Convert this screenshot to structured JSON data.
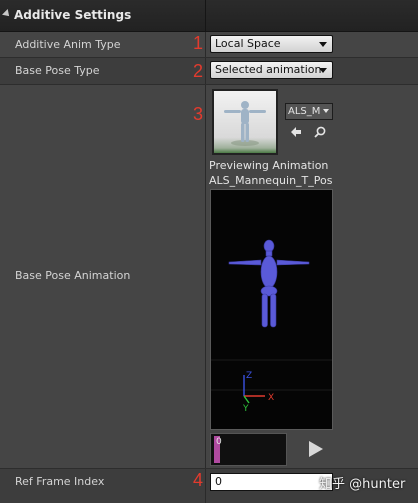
{
  "section": {
    "title": "Additive Settings"
  },
  "rows": {
    "additive_anim_type": {
      "label": "Additive Anim Type",
      "value": "Local Space",
      "marker": "1"
    },
    "base_pose_type": {
      "label": "Base Pose Type",
      "value": "Selected animation",
      "marker": "2"
    },
    "base_pose_animation": {
      "label": "Base Pose Animation",
      "marker": "3",
      "asset_combo": "ALS_M",
      "preview_line1": "Previewing Animation",
      "preview_line2": "ALS_Mannequin_T_Pos",
      "scrub_frame": "0"
    },
    "ref_frame_index": {
      "label": "Ref Frame Index",
      "value": "0",
      "marker": "4"
    }
  },
  "axis_labels": {
    "x": "X",
    "y": "Y",
    "z": "Z"
  },
  "watermark": "知乎 @hunter",
  "colors": {
    "marker": "#e23b2e",
    "mannequin": "#5a5ad8",
    "axis_x": "#e23b2e",
    "axis_y": "#2ec23b",
    "axis_z": "#3b52e2"
  },
  "icons": {
    "thumbnail": "mannequin-thumbnail",
    "back": "arrow-left-icon",
    "browse": "search-icon",
    "play": "play-icon"
  }
}
